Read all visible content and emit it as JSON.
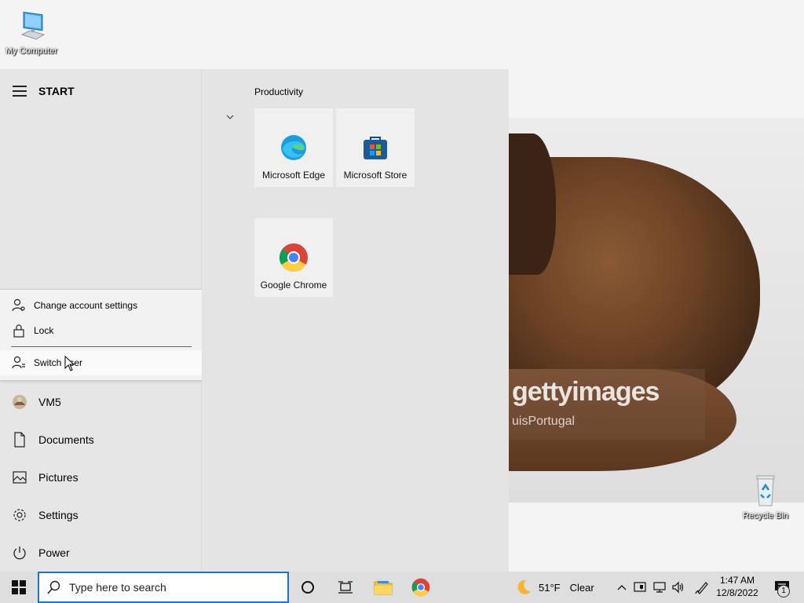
{
  "desktop": {
    "icons": [
      {
        "label": "My Computer"
      },
      {
        "label": "Recycle Bin"
      }
    ],
    "wallpaper": {
      "watermark": "gettyimages",
      "watermark_sub": "uisPortugal"
    }
  },
  "start_menu": {
    "title": "START",
    "account_menu": {
      "items": [
        {
          "label": "Change account settings",
          "icon": "person-gear-icon"
        },
        {
          "label": "Lock",
          "icon": "lock-icon"
        },
        {
          "label": "Switch user",
          "icon": "switch-user-icon"
        }
      ]
    },
    "nav": [
      {
        "label": "VM5",
        "icon": "avatar"
      },
      {
        "label": "Documents",
        "icon": "document-icon"
      },
      {
        "label": "Pictures",
        "icon": "picture-icon"
      },
      {
        "label": "Settings",
        "icon": "gear-icon"
      },
      {
        "label": "Power",
        "icon": "power-icon"
      }
    ],
    "tiles_group": {
      "title": "Productivity",
      "tiles": [
        {
          "label": "Microsoft Edge",
          "icon": "edge-icon"
        },
        {
          "label": "Microsoft Store",
          "icon": "store-icon"
        },
        {
          "label": "Google Chrome",
          "icon": "chrome-icon"
        }
      ]
    }
  },
  "taskbar": {
    "search_placeholder": "Type here to search",
    "weather": {
      "temp": "51°F",
      "condition": "Clear"
    },
    "clock": {
      "time": "1:47 AM",
      "date": "12/8/2022"
    },
    "notification_count": "1"
  },
  "colors": {
    "accent": "#1a73c6",
    "start_bg": "#e6e6e6",
    "taskbar_bg": "#dedede"
  }
}
